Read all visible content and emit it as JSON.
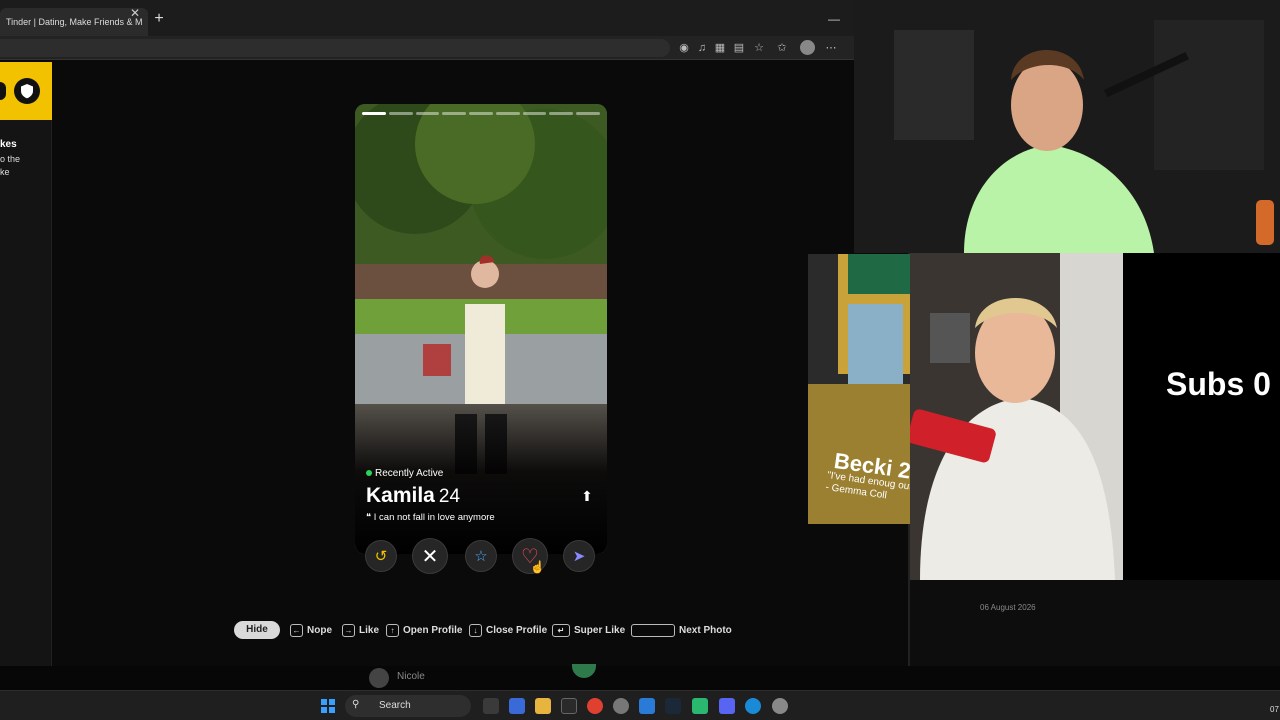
{
  "browser": {
    "tab_title": "Tinder | Dating, Make Friends & M",
    "tab_close": "✕",
    "new_tab": "+",
    "minimize": "—",
    "toolbar_icons": [
      "location-icon",
      "bell-icon",
      "extensions-icon",
      "reading-list-icon",
      "favorite-icon",
      "collections-icon",
      "profile-icon",
      "more-icon"
    ]
  },
  "left_panel": {
    "heading_fragment": "kes",
    "text_fragment_1": "o the",
    "text_fragment_2": "ke"
  },
  "profile": {
    "status": "Recently Active",
    "name": "Kamila",
    "age": "24",
    "bio": "I can not fall in love anymore",
    "photo_count": 9,
    "current_photo": 1
  },
  "actions": {
    "rewind": "rewind-icon",
    "nope": "close-icon",
    "super_like": "star-icon",
    "like": "heart-icon",
    "boost": "send-icon"
  },
  "shortcuts": {
    "hide": "Hide",
    "nope": "Nope",
    "like": "Like",
    "open_profile": "Open Profile",
    "close_profile": "Close Profile",
    "super_like": "Super Like",
    "next_photo": "Next Photo"
  },
  "behind": {
    "contact_name": "Nicole"
  },
  "taskbar": {
    "search_label": "Search",
    "clock_fragment": "07"
  },
  "overlays": {
    "side_card_name": "Becki 2",
    "side_card_quote": "\"I've had enoug out\" - Gemma Coll",
    "subs_text": "Subs 0",
    "date_label": "06 August 2026"
  },
  "colors": {
    "brand_yellow": "#f2c200",
    "like_red": "#ff4f5e",
    "active_green": "#29d65a"
  }
}
